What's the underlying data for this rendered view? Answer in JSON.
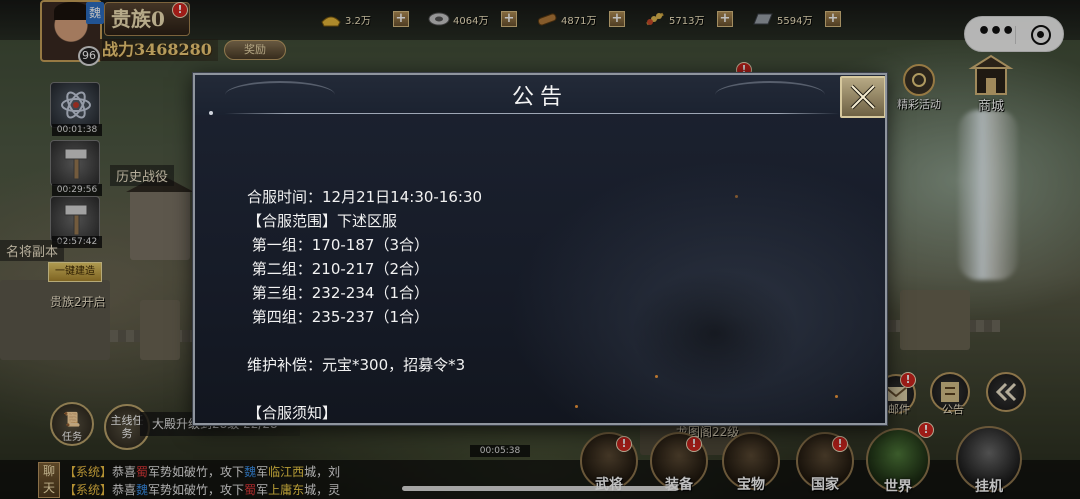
{
  "player": {
    "faction": "魏",
    "level": "96",
    "noble_label": "贵族0",
    "noble_alert": "!",
    "power_label": "战力3468280",
    "hint": "奖励"
  },
  "resources": [
    {
      "name": "gold-ingot",
      "value": "3.2万"
    },
    {
      "name": "silver",
      "value": "4064万"
    },
    {
      "name": "wood",
      "value": "4871万"
    },
    {
      "name": "grain",
      "value": "5713万"
    },
    {
      "name": "iron",
      "value": "5594万"
    }
  ],
  "left_panel": {
    "timers": [
      "00:01:38",
      "00:29:56",
      "02:57:42"
    ],
    "history_battle": "历史战役",
    "famous_general": "名将副本",
    "quick_build": "一键建造",
    "noble_open": "贵族2开启"
  },
  "right_panel": {
    "event": "精彩活动",
    "shop": "商城",
    "mail": "邮件",
    "notice": "公告"
  },
  "bottom": {
    "task": "任务",
    "main_quest_circle": "主线任务",
    "main_quest_text": "大殿升级到28级 22/28",
    "dragon_pavilion": "龙图阁22级",
    "timer": "00:05:38",
    "nav": [
      "武将",
      "装备",
      "宝物",
      "国家",
      "世界",
      "挂机"
    ]
  },
  "chat": {
    "tab_label": "聊天",
    "lines": [
      {
        "sys": "【系统】",
        "pre": "恭喜",
        "k1": "蜀",
        "mid": "军势如破竹，攻下",
        "k2": "魏",
        "mid2": "军",
        "city": "临江西",
        "post": "城，刘"
      },
      {
        "sys": "【系统】",
        "pre": "恭喜",
        "k1": "魏",
        "mid": "军势如破竹，攻下",
        "k2": "蜀",
        "mid2": "军",
        "city": "上庸东",
        "post": "城，灵"
      }
    ]
  },
  "modal": {
    "title": "公告",
    "lines": [
      "合服时间：12月21日14:30-16:30",
      "【合服范围】下述区服",
      " 第一组：170-187（3合）",
      " 第二组：210-217（2合）",
      " 第三组：232-234（1合）",
      " 第四组：235-237（1合）",
      "",
      "维护补偿：元宝*300，招募令*3",
      "",
      "【合服须知】"
    ]
  }
}
